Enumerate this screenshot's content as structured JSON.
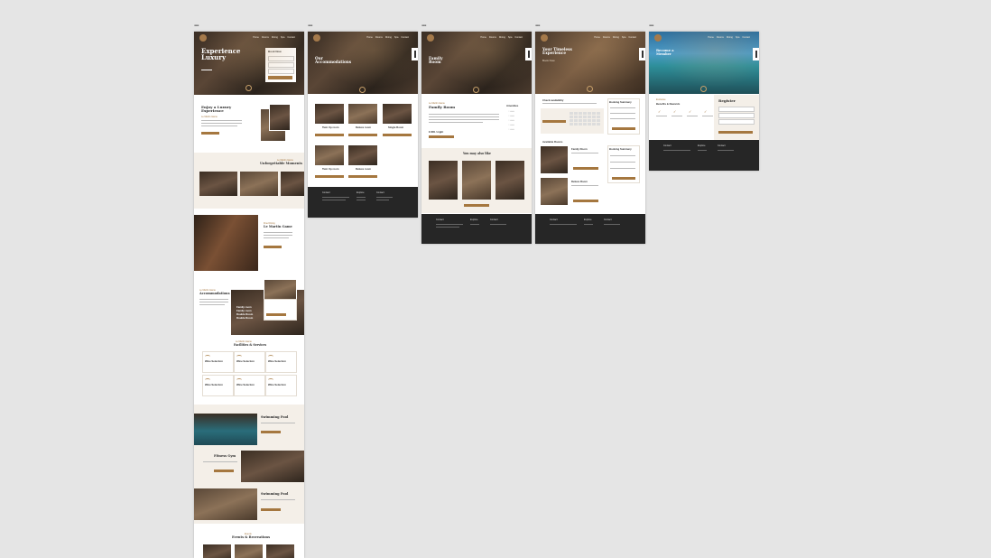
{
  "frames": [
    {
      "label": "▪▪▪"
    },
    {
      "label": "▪▪▪"
    },
    {
      "label": "▪▪▪"
    },
    {
      "label": "▪▪▪"
    },
    {
      "label": "▪▪▪"
    }
  ],
  "home": {
    "hero_title": "Experience Luxury",
    "booking_title": "Book Now",
    "intro_heading": "Enjoy a Luxury Experience",
    "intro_tag": "Le Martin Game",
    "gallery_tag": "Le Martin Game",
    "gallery_heading": "Unforgettable Moments",
    "dining_tag": "Fine Dining",
    "dining_heading": "Le Martin Game",
    "acc_tag": "Le Martin Game",
    "acc_heading": "Accommodations",
    "acc_list": [
      "Family room",
      "Family room",
      "Double Room",
      "Double Room"
    ],
    "facilities_tag": "Le Martin Game",
    "facilities_heading": "Facilities & Services",
    "facilities": [
      "Wine Selection",
      "Wine Selection",
      "Wine Selection",
      "Wine Selection",
      "Wine Selection",
      "Wine Selection"
    ],
    "features": [
      "Swimming Pool",
      "Fitness Gym",
      "Swimming Pool"
    ],
    "events_tag": "Events",
    "events_heading": "Events & Recreations"
  },
  "accommodations": {
    "hero_title": "Our Accommodations",
    "rooms": [
      "Twin Up room",
      "Deluxe room",
      "Single Room",
      "Twin Up room",
      "Deluxe room"
    ],
    "footer_cols": [
      "Contact",
      "Explore",
      "Contact"
    ]
  },
  "family_room": {
    "hero_title": "Family Room",
    "tag": "Le Martin Game",
    "heading": "Family Room",
    "price": "€ 800 / night",
    "amenities_heading": "Amenities",
    "also_like": "You may also like",
    "footer_cols": [
      "Contact",
      "Explore",
      "Contact"
    ]
  },
  "booking": {
    "hero_title": "Your Timeless Experience",
    "hero_sub": "Book Now",
    "availability": "Check availability",
    "summary_title": "Booking Summary",
    "available_rooms": "Available Rooms",
    "room1": "Family Room",
    "room2": "Deluxe Room",
    "summary2": "Booking Summary",
    "footer_cols": [
      "Contact",
      "Explore",
      "Contact"
    ]
  },
  "register": {
    "hero_title": "Become a Member",
    "benefits_tag": "Exclusive",
    "benefits_heading": "Benefits & Rewards",
    "register_title": "Register",
    "footer_cols": [
      "Contact",
      "Explore",
      "Contact"
    ]
  },
  "colors": {
    "accent": "#a5773f",
    "dark": "#262626",
    "beige": "#f4efe8"
  }
}
